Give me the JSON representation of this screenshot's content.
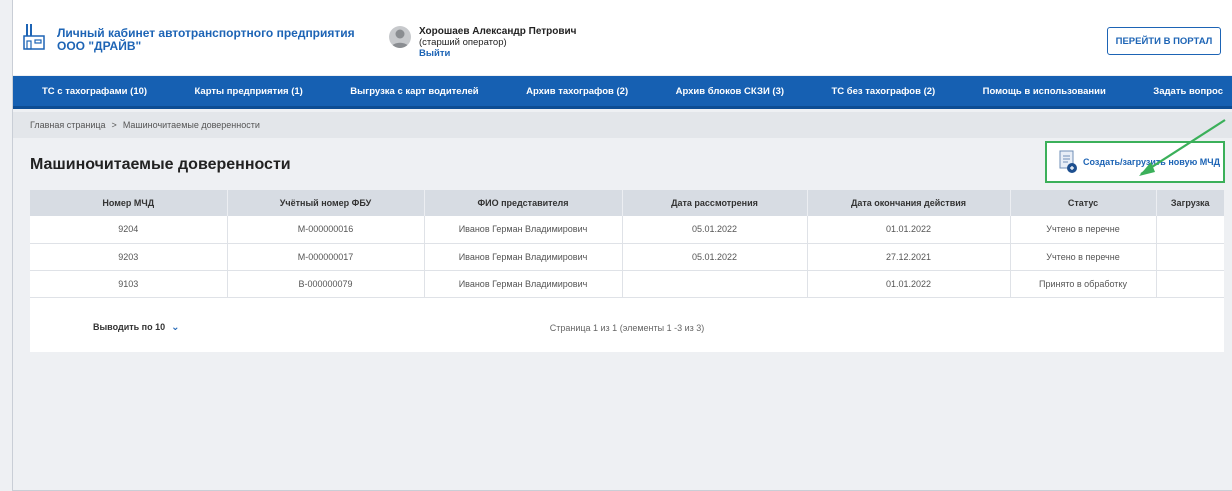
{
  "header": {
    "brand_line1": "Личный кабинет автотранспортного предприятия",
    "brand_line2": "ООО \"ДРАЙВ\"",
    "user_name": "Хорошаев Александр Петрович",
    "user_role": "(старший оператор)",
    "logout": "Выйти",
    "portal_button": "ПЕРЕЙТИ В ПОРТАЛ"
  },
  "nav": [
    "ТС с тахографами (10)",
    "Карты предприятия (1)",
    "Выгрузка с карт водителей",
    "Архив тахографов (2)",
    "Архив блоков СКЗИ (3)",
    "ТС без тахографов (2)",
    "Помощь в использовании",
    "Задать вопрос"
  ],
  "breadcrumb": {
    "home": "Главная страница",
    "separator": ">",
    "current": "Машиночитаемые доверенности"
  },
  "page": {
    "title": "Машиночитаемые доверенности",
    "create_button": "Создать/загрузить новую МЧД"
  },
  "table": {
    "columns": [
      "Номер МЧД",
      "Учётный номер ФБУ",
      "ФИО представителя",
      "Дата рассмотрения",
      "Дата окончания действия",
      "Статус",
      "Загрузка"
    ],
    "rows": [
      [
        "9204",
        "М-000000016",
        "Иванов Герман Владимирович",
        "05.01.2022",
        "01.01.2022",
        "Учтено в перечне",
        ""
      ],
      [
        "9203",
        "М-000000017",
        "Иванов Герман Владимирович",
        "05.01.2022",
        "27.12.2021",
        "Учтено в перечне",
        ""
      ],
      [
        "9103",
        "В-000000079",
        "Иванов Герман Владимирович",
        "",
        "01.01.2022",
        "Принято в обработку",
        ""
      ]
    ]
  },
  "footer": {
    "per_page": "Выводить по 10",
    "paging": "Страница 1 из 1 (элементы 1 -3 из 3)"
  },
  "colors": {
    "accent": "#1660b2",
    "highlight": "#3bb05a"
  }
}
